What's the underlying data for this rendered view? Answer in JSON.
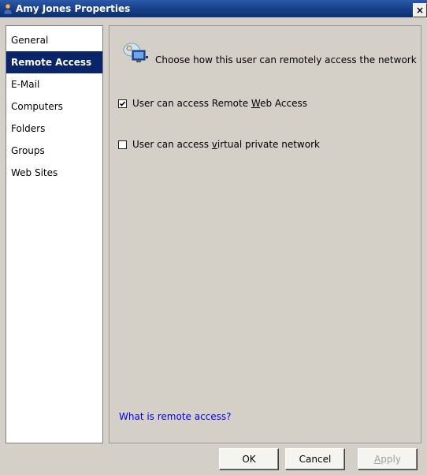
{
  "window": {
    "title": "Amy Jones Properties",
    "close_label": "×"
  },
  "nav": {
    "items": [
      {
        "label": "General",
        "active": false
      },
      {
        "label": "Remote Access",
        "active": true
      },
      {
        "label": "E-Mail",
        "active": false
      },
      {
        "label": "Computers",
        "active": false
      },
      {
        "label": "Folders",
        "active": false
      },
      {
        "label": "Groups",
        "active": false
      },
      {
        "label": "Web Sites",
        "active": false
      }
    ]
  },
  "panel": {
    "header_text": "Choose how this user can remotely access the network",
    "checkboxes": [
      {
        "label_before": "User can access Remote ",
        "accel": "W",
        "label_after": "eb Access",
        "checked": true
      },
      {
        "label_before": "User can access ",
        "accel": "v",
        "label_after": "irtual private network",
        "checked": false
      }
    ],
    "help_link": "What is remote access?"
  },
  "buttons": {
    "ok": "OK",
    "cancel": "Cancel",
    "apply_accel": "A",
    "apply_rest": "pply"
  },
  "colors": {
    "titlebar": "#18408a",
    "selection": "#0a246a",
    "dialog_bg": "#d4d0c8",
    "link": "#0000ee"
  }
}
